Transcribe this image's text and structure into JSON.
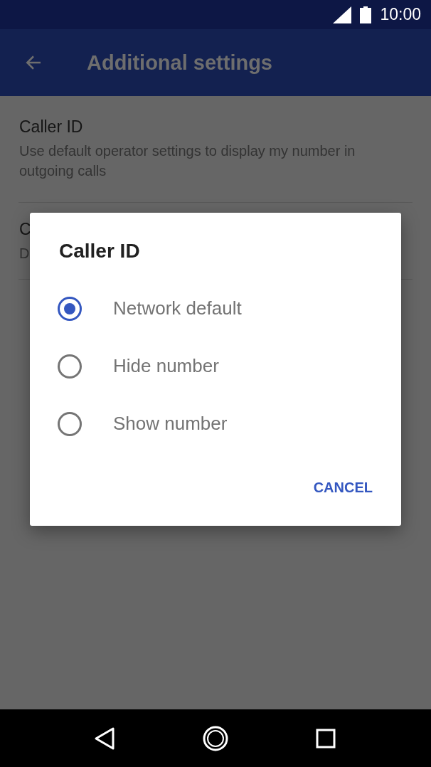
{
  "status_bar": {
    "time": "10:00"
  },
  "app_bar": {
    "title": "Additional settings"
  },
  "settings": [
    {
      "title": "Caller ID",
      "description": "Use default operator settings to display my number in outgoing calls"
    },
    {
      "title": "C",
      "description": "D"
    }
  ],
  "dialog": {
    "title": "Caller ID",
    "options": [
      {
        "label": "Network default",
        "selected": true
      },
      {
        "label": "Hide number",
        "selected": false
      },
      {
        "label": "Show number",
        "selected": false
      }
    ],
    "buttons": [
      "CANCEL"
    ]
  }
}
